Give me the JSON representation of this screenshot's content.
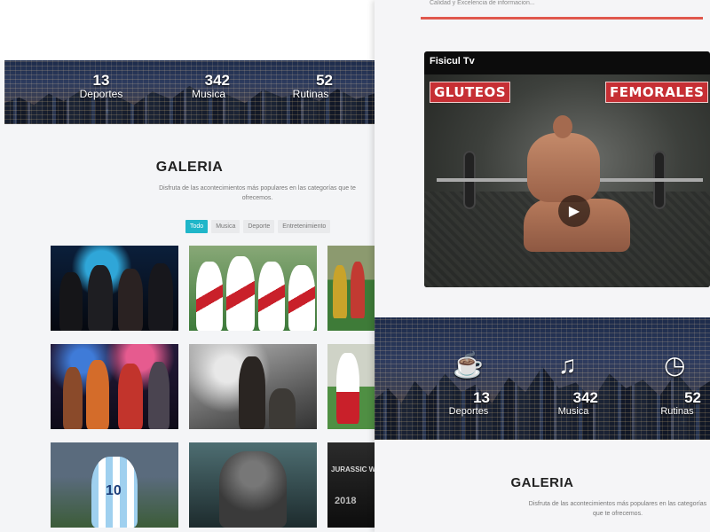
{
  "left": {
    "stats": [
      {
        "number": "13",
        "label": "Deportes"
      },
      {
        "number": "342",
        "label": "Musica"
      },
      {
        "number": "52",
        "label": "Rutinas"
      }
    ],
    "gallery": {
      "title": "GALERIA",
      "subtitle": "Disfruta de las acontecimientos más populares en las categorías que te ofrecemos.",
      "filters": [
        "Todo",
        "Musica",
        "Deporte",
        "Entretenimiento"
      ],
      "active_filter": "Todo"
    },
    "thumb_labels": {
      "jurassic": "JURASSIC WO",
      "jurassic_year": "2018",
      "jersey_number": "10"
    }
  },
  "right": {
    "slogan": "Calidad y Excelencia de informacion...",
    "video": {
      "title": "Fisicul Tv",
      "sign_left": "GLUTEOS",
      "sign_right": "FEMORALES"
    },
    "stats": [
      {
        "icon": "coffee-cup-icon",
        "number": "13",
        "label": "Deportes"
      },
      {
        "icon": "music-note-icon",
        "number": "342",
        "label": "Musica"
      },
      {
        "icon": "clock-icon",
        "number": "52",
        "label": "Rutinas"
      }
    ],
    "gallery": {
      "title": "GALERIA",
      "subtitle": "Disfruta de las acontecimientos más populares en las categorías que te ofrecemos."
    }
  },
  "colors": {
    "accent_teal": "#1fb6c9",
    "accent_red": "#e0584d",
    "sign_red": "#c62f34"
  }
}
